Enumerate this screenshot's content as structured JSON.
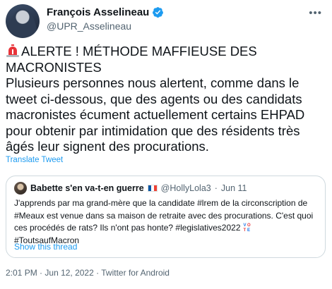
{
  "author": {
    "display_name": "François Asselineau",
    "handle": "@UPR_Asselineau",
    "verified": true
  },
  "more_icon": "more-options-icon",
  "tweet": {
    "text_line1": "ALERTE ! MÉTHODE MAFFIEUSE DES MACRONISTES",
    "text_line2": "Plusieurs personnes nous alertent, comme dans le tweet ci-dessous, que des agents ou des candidats macronistes écument actuellement certains EHPAD pour obtenir par intimidation que des résidents très âgés leur signent des procurations.",
    "emoji": "rotating-light-icon"
  },
  "translate_label": "Translate Tweet",
  "quote": {
    "display_name": "Babette s'en va-t-en guerre",
    "handle": "@HollyLola3",
    "separator": "·",
    "date": "Jun 11",
    "text": "J'apprends par ma grand-mère que la candidate #lrem de la circonscription de #Meaux est venue dans sa maison de retraite avec des procurations. C'est quoi ces procédés de rats? Ils n'ont pas honte? #legislatives2022",
    "hashtag_tail": "#ToutsaufMacron",
    "show_thread": "Show this thread"
  },
  "meta": {
    "time": "2:01 PM",
    "sep1": "·",
    "date": "Jun 12, 2022",
    "sep2": "·",
    "source": "Twitter for Android"
  },
  "colors": {
    "link": "#1d9bf0",
    "secondary": "#536471",
    "text": "#0f1419",
    "border": "#cfd9de"
  }
}
